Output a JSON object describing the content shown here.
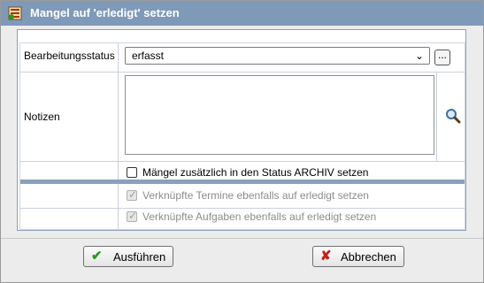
{
  "window": {
    "title": "Mangel auf 'erledigt' setzen"
  },
  "form": {
    "status_label": "Bearbeitungsstatus",
    "status_value": "erfasst",
    "more_button": "...",
    "notes_label": "Notizen",
    "notes_value": "",
    "archive_checkbox": {
      "label": "Mängel zusätzlich in den Status ARCHIV setzen",
      "checked": false
    },
    "termine_checkbox": {
      "label": "Verknüpfte Termine ebenfalls auf erledigt setzen",
      "checked": true,
      "disabled": true
    },
    "aufgaben_checkbox": {
      "label": "Verknüpfte Aufgaben ebenfalls auf erledigt setzen",
      "checked": true,
      "disabled": true
    }
  },
  "footer": {
    "execute_label": "Ausführen",
    "cancel_label": "Abbrechen"
  },
  "colors": {
    "titlebar": "#7f99b9",
    "panel_border": "#8aa1bd",
    "execute_icon": "#2a9a1f",
    "cancel_icon": "#c4211b"
  }
}
